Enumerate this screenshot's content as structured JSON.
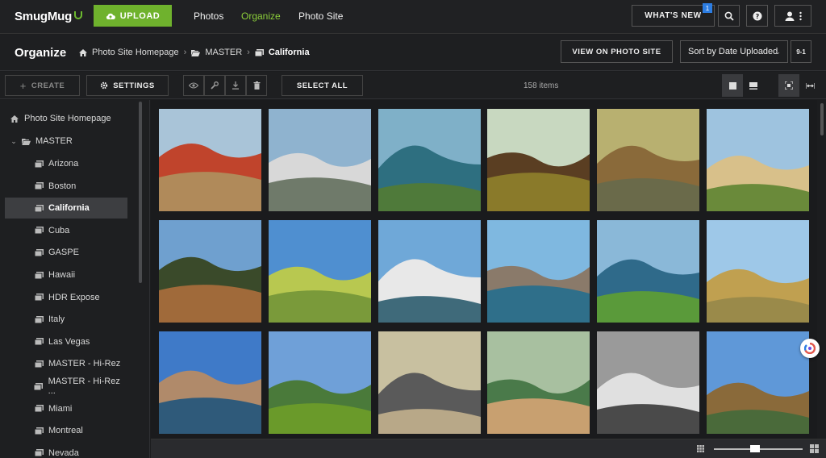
{
  "app": {
    "logo_text": "SmugMug"
  },
  "topnav": {
    "upload_label": "UPLOAD",
    "links": [
      "Photos",
      "Organize",
      "Photo Site"
    ],
    "active_link": "Organize",
    "whats_new_label": "WHAT'S NEW",
    "whats_new_badge": "1",
    "accent": "#6fb22d"
  },
  "header": {
    "title": "Organize",
    "breadcrumbs": [
      "Photo Site Homepage",
      "MASTER",
      "California"
    ],
    "view_button": "VIEW ON PHOTO SITE",
    "sort_label": "Sort by Date Uploaded",
    "sort_order": "9-1"
  },
  "toolbar": {
    "create_label": "CREATE",
    "settings_label": "SETTINGS",
    "select_all_label": "SELECT ALL",
    "items_count": "158 items"
  },
  "sidebar": {
    "items": [
      {
        "label": "Photo Site Homepage",
        "icon": "home-icon"
      },
      {
        "label": "MASTER",
        "icon": "folder-icon"
      },
      {
        "label": "Arizona",
        "icon": "gallery-icon"
      },
      {
        "label": "Boston",
        "icon": "gallery-icon"
      },
      {
        "label": "California",
        "icon": "gallery-icon",
        "selected": true
      },
      {
        "label": "Cuba",
        "icon": "gallery-icon"
      },
      {
        "label": "GASPE",
        "icon": "gallery-icon"
      },
      {
        "label": "Hawaii",
        "icon": "gallery-icon"
      },
      {
        "label": "HDR Expose",
        "icon": "gallery-icon"
      },
      {
        "label": "Italy",
        "icon": "gallery-icon"
      },
      {
        "label": "Las Vegas",
        "icon": "gallery-icon"
      },
      {
        "label": "MASTER - Hi-Rez",
        "icon": "gallery-icon"
      },
      {
        "label": "MASTER - Hi-Rez ...",
        "icon": "gallery-icon"
      },
      {
        "label": "Miami",
        "icon": "gallery-icon"
      },
      {
        "label": "Montreal",
        "icon": "gallery-icon"
      },
      {
        "label": "Nevada",
        "icon": "gallery-icon"
      }
    ]
  },
  "photos": [
    {
      "name": "photo-golden-gate-bridge",
      "sky": "#a9c4d8",
      "ground": "#b08a5a",
      "accent": "#c0442c"
    },
    {
      "name": "photo-san-francisco-city",
      "sky": "#8fb3cf",
      "ground": "#6f7a6a",
      "accent": "#d8d8d8"
    },
    {
      "name": "photo-coastal-bay",
      "sky": "#7fb0c8",
      "ground": "#4f7a3a",
      "accent": "#2e6f80"
    },
    {
      "name": "photo-forest-trees",
      "sky": "#c8d8c0",
      "ground": "#8a7a2a",
      "accent": "#5a3e22"
    },
    {
      "name": "photo-eucalyptus-road",
      "sky": "#b8b070",
      "ground": "#6a6a4a",
      "accent": "#8a6a3a"
    },
    {
      "name": "photo-big-sur-beach",
      "sky": "#9ec3df",
      "ground": "#6a8a3a",
      "accent": "#d8c08a"
    },
    {
      "name": "photo-cypress-tree",
      "sky": "#6fa0cf",
      "ground": "#a06a3a",
      "accent": "#3a4a2a"
    },
    {
      "name": "photo-waterfall-trees",
      "sky": "#4f8fd0",
      "ground": "#7a9a3a",
      "accent": "#b8c850"
    },
    {
      "name": "photo-mountain-lake",
      "sky": "#6fa8d8",
      "ground": "#3f6a7a",
      "accent": "#e8e8e8"
    },
    {
      "name": "photo-rock-in-water",
      "sky": "#7fb8e0",
      "ground": "#2f6f8a",
      "accent": "#8a7a6a"
    },
    {
      "name": "photo-coastal-cliffs",
      "sky": "#8ab8d8",
      "ground": "#5a9a3a",
      "accent": "#2f6a8a"
    },
    {
      "name": "photo-rock-arch",
      "sky": "#9ec8e8",
      "ground": "#9a8a4a",
      "accent": "#c0a050"
    },
    {
      "name": "photo-morro-rock-harbor",
      "sky": "#3f7ac8",
      "ground": "#2f5a7a",
      "accent": "#b08a6a"
    },
    {
      "name": "photo-green-hill",
      "sky": "#6fa0d8",
      "ground": "#6a9a2a",
      "accent": "#4a7a3a"
    },
    {
      "name": "photo-sand-dunes-rock",
      "sky": "#c8c0a0",
      "ground": "#b8a888",
      "accent": "#5a5a5a"
    },
    {
      "name": "photo-dunes-morro-rock",
      "sky": "#a8c0a0",
      "ground": "#c8a070",
      "accent": "#4a7a4a"
    },
    {
      "name": "photo-bw-mountains",
      "sky": "#9a9a9a",
      "ground": "#4a4a4a",
      "accent": "#e0e0e0"
    },
    {
      "name": "photo-yosemite-valley",
      "sky": "#5f98d8",
      "ground": "#4a6a3a",
      "accent": "#8a6a3a"
    }
  ]
}
